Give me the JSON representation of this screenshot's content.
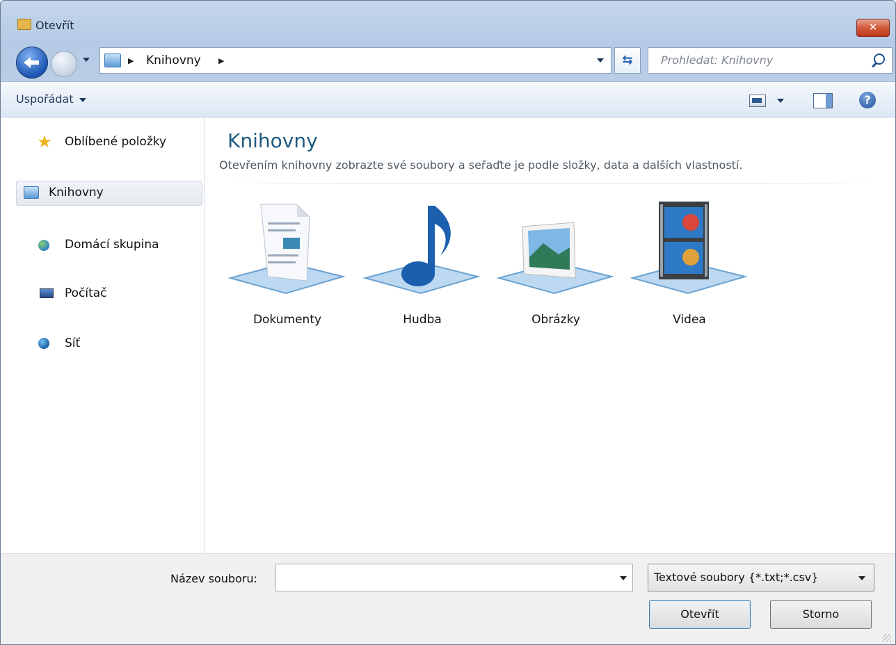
{
  "window": {
    "title": "Otevřít",
    "close_label": "✕"
  },
  "nav": {
    "breadcrumb": [
      "Knihovny"
    ],
    "search_placeholder": "Prohledat: Knihovny",
    "refresh_glyph": "⇆"
  },
  "toolbar": {
    "organize_label": "Uspořádat",
    "help_glyph": "?"
  },
  "sidebar": {
    "items": [
      {
        "label": "Oblíbené položky",
        "icon": "star-icon",
        "selected": false
      },
      {
        "label": "Knihovny",
        "icon": "libraries-icon",
        "selected": true
      },
      {
        "label": "Domácí skupina",
        "icon": "homegroup-icon",
        "selected": false
      },
      {
        "label": "Počítač",
        "icon": "computer-icon",
        "selected": false
      },
      {
        "label": "Síť",
        "icon": "network-icon",
        "selected": false
      }
    ]
  },
  "main": {
    "title": "Knihovny",
    "subtitle": "Otevřením knihovny zobrazte své soubory a seřaďte je podle složky, data a dalších vlastností.",
    "libraries": [
      {
        "label": "Dokumenty",
        "icon": "documents-library-icon"
      },
      {
        "label": "Hudba",
        "icon": "music-library-icon"
      },
      {
        "label": "Obrázky",
        "icon": "pictures-library-icon"
      },
      {
        "label": "Videa",
        "icon": "videos-library-icon"
      }
    ]
  },
  "bottom": {
    "filename_label": "Název souboru:",
    "filename_value": "",
    "filetype_value": "Textové soubory {*.txt;*.csv}",
    "open_label": "Otevřít",
    "cancel_label": "Storno"
  },
  "colors": {
    "accent": "#1d5b80",
    "frame": "#b9cde6",
    "close": "#d2583b"
  }
}
